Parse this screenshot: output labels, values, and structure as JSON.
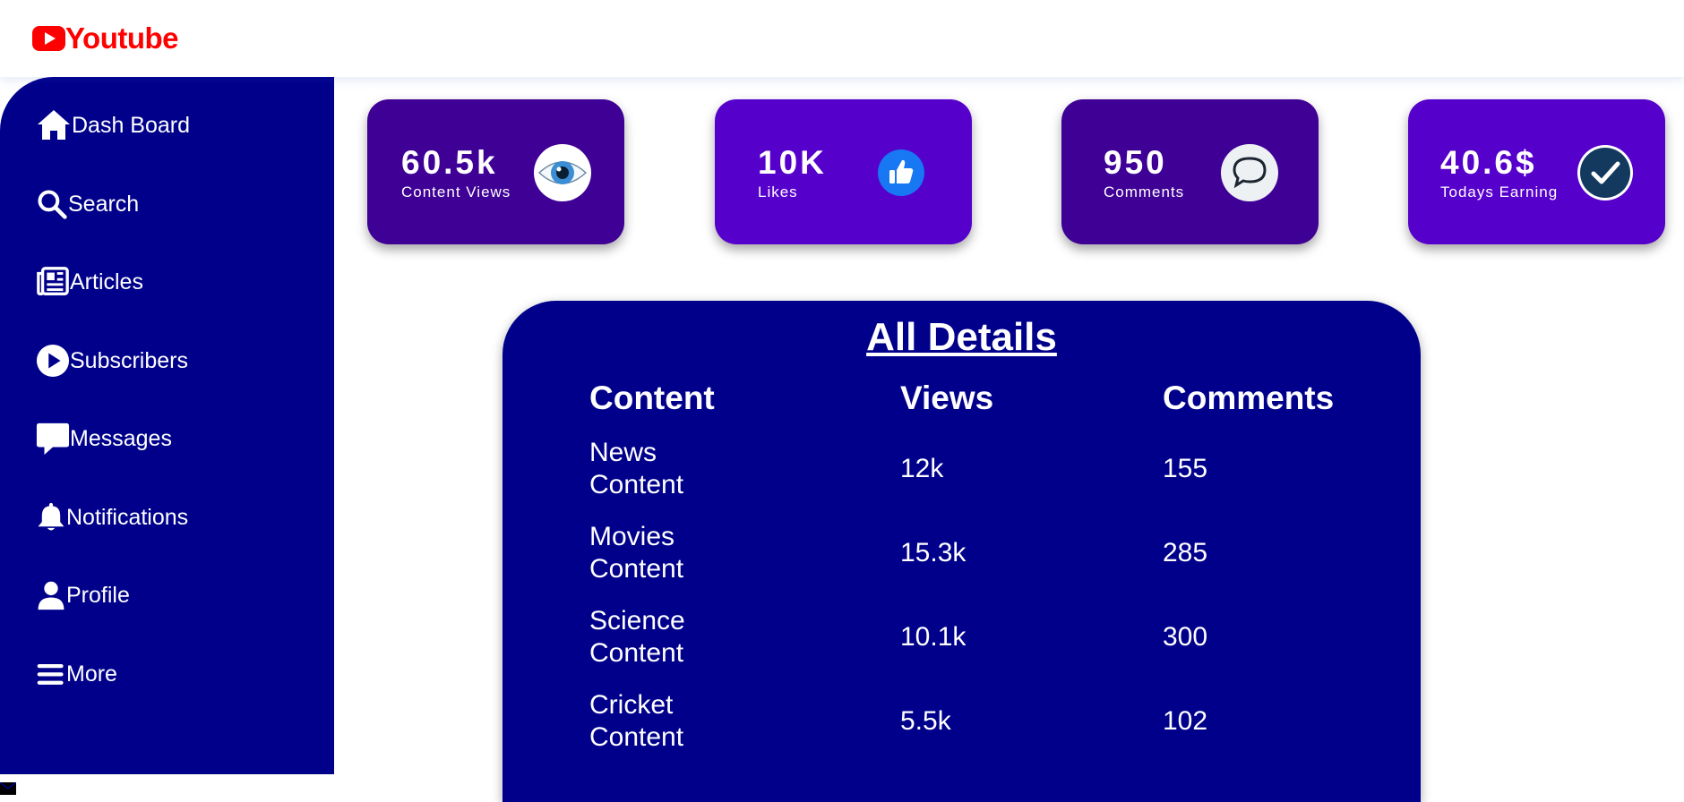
{
  "app": {
    "logo_text": "Youtube",
    "accent_color": "#ff0000"
  },
  "sidebar": {
    "items": [
      {
        "label": "Dash Board",
        "icon": "home-icon"
      },
      {
        "label": "Search",
        "icon": "search-icon"
      },
      {
        "label": "Articles",
        "icon": "newspaper-icon"
      },
      {
        "label": "Subscribers",
        "icon": "play-circle-icon"
      },
      {
        "label": "Messages",
        "icon": "message-icon"
      },
      {
        "label": "Notifications",
        "icon": "bell-icon"
      },
      {
        "label": "Profile",
        "icon": "user-icon"
      },
      {
        "label": "More",
        "icon": "menu-icon"
      }
    ]
  },
  "cards": [
    {
      "value": "60.5k",
      "label": "Content Views",
      "icon": "eye-icon"
    },
    {
      "value": "10K",
      "label": "Likes",
      "icon": "thumbs-up-icon"
    },
    {
      "value": "950",
      "label": "Comments",
      "icon": "comment-bubble-icon"
    },
    {
      "value": "40.6$",
      "label": "Todays Earning",
      "icon": "checkmark-icon"
    }
  ],
  "details": {
    "title": "All Details",
    "columns": [
      "Content",
      "Views",
      "Comments"
    ],
    "rows": [
      {
        "content": [
          "News",
          "Content"
        ],
        "views": "12k",
        "comments": "155"
      },
      {
        "content": [
          "Movies",
          "Content"
        ],
        "views": "15.3k",
        "comments": "285"
      },
      {
        "content": [
          "Science",
          "Content"
        ],
        "views": "10.1k",
        "comments": "300"
      },
      {
        "content": [
          "Cricket",
          "Content"
        ],
        "views": "5.5k",
        "comments": "102"
      }
    ]
  },
  "colors": {
    "sidebar_bg": "#00008b",
    "card_dark": "#3f0096",
    "card_light": "#5600cc",
    "panel_bg": "#00008b"
  }
}
